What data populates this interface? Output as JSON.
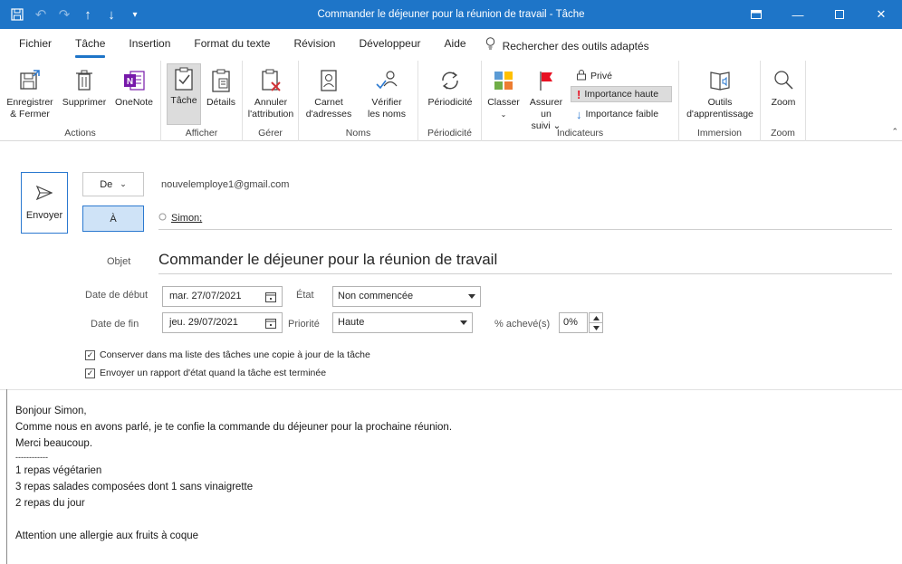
{
  "window": {
    "title": "Commander le déjeuner pour la réunion de travail  -  Tâche"
  },
  "tabs": [
    {
      "label": "Fichier"
    },
    {
      "label": "Tâche"
    },
    {
      "label": "Insertion"
    },
    {
      "label": "Format du texte"
    },
    {
      "label": "Révision"
    },
    {
      "label": "Développeur"
    },
    {
      "label": "Aide"
    }
  ],
  "tell_me": {
    "label": "Rechercher des outils adaptés"
  },
  "ribbon": {
    "actions": {
      "save_close": "Enregistrer",
      "save_close_2": "& Fermer",
      "delete": "Supprimer",
      "onenote": "OneNote",
      "group": "Actions"
    },
    "show": {
      "task": "Tâche",
      "details": "Détails",
      "group": "Afficher"
    },
    "manage": {
      "cancel": "Annuler",
      "cancel_2": "l'attribution",
      "group": "Gérer"
    },
    "names": {
      "address_book": "Carnet",
      "address_book_2": "d'adresses",
      "check_names": "Vérifier",
      "check_names_2": "les noms",
      "group": "Noms"
    },
    "recurrence": {
      "recurrence": "Périodicité",
      "group": "Périodicité"
    },
    "tags": {
      "categorize": "Classer",
      "follow_up": "Assurer un",
      "follow_up_2": "suivi",
      "private": "Privé",
      "high_importance": "Importance haute",
      "low_importance": "Importance faible",
      "group": "Indicateurs"
    },
    "immersive": {
      "tools": "Outils",
      "tools_2": "d'apprentissage",
      "group": "Immersion"
    },
    "zoom": {
      "zoom": "Zoom",
      "group": "Zoom"
    }
  },
  "form": {
    "send_label": "Envoyer",
    "from_label": "De",
    "from_value": "nouvelemploye1@gmail.com",
    "to_label": "À",
    "to_recipient": "Simon;",
    "subject_label": "Objet",
    "subject_value": "Commander le déjeuner pour la réunion de travail",
    "start_label": "Date de début",
    "start_value": "mar. 27/07/2021",
    "due_label": "Date de fin",
    "due_value": "jeu. 29/07/2021",
    "status_label": "État",
    "status_value": "Non commencée",
    "priority_label": "Priorité",
    "priority_value": "Haute",
    "pct_label": "% achevé(s)",
    "pct_value": "0%",
    "chk1": "Conserver dans ma liste des tâches une copie à jour de la tâche",
    "chk2": "Envoyer un rapport d'état quand la tâche est terminée"
  },
  "body": {
    "lines": [
      "Bonjour Simon,",
      "Comme nous en avons parlé, je te confie la commande du déjeuner pour la prochaine réunion.",
      "Merci beaucoup.",
      "------------",
      "1 repas végétarien",
      "3 repas salades composées dont 1 sans vinaigrette",
      "2 repas du jour",
      "",
      "Attention une allergie aux fruits à coque"
    ]
  }
}
